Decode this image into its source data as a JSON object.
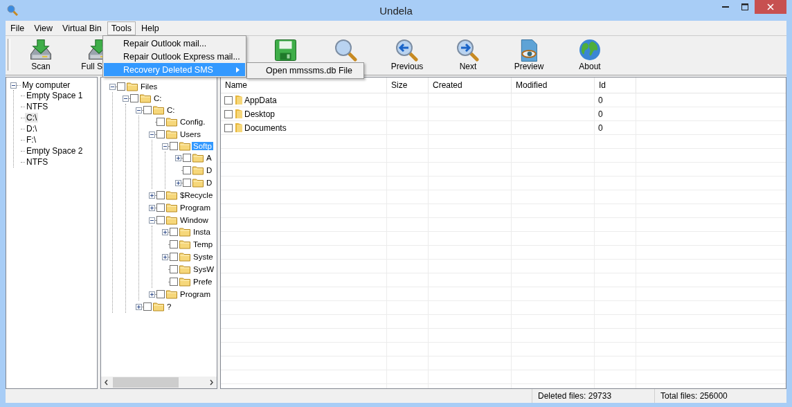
{
  "window": {
    "title": "Undela"
  },
  "menu": [
    {
      "label": "File",
      "open": false
    },
    {
      "label": "View",
      "open": false
    },
    {
      "label": "Virtual Bin",
      "open": false
    },
    {
      "label": "Tools",
      "open": true
    },
    {
      "label": "Help",
      "open": false
    }
  ],
  "dropdown": [
    {
      "label": "Repair Outlook mail...",
      "selected": false,
      "submenu": false
    },
    {
      "label": "Repair Outlook Express mail...",
      "selected": false,
      "submenu": false
    },
    {
      "label": "Recovery Deleted SMS",
      "selected": true,
      "submenu": true
    }
  ],
  "submenu": [
    {
      "label": "Open mmssms.db File"
    }
  ],
  "toolbar": [
    {
      "kind": "scan",
      "label": "Scan"
    },
    {
      "kind": "full",
      "label": "Full S"
    },
    {
      "kind": "save"
    },
    {
      "kind": "search"
    },
    {
      "kind": "previous",
      "label": "Previous"
    },
    {
      "kind": "next",
      "label": "Next"
    },
    {
      "kind": "preview",
      "label": "Preview"
    },
    {
      "kind": "about",
      "label": "About"
    }
  ],
  "computer_tree": [
    {
      "label": "My computer",
      "expander": true,
      "expanded": true,
      "selected": false,
      "children": [
        {
          "label": "Empty Space 1",
          "expander": false,
          "selected": false
        },
        {
          "label": "NTFS",
          "expander": false,
          "selected": false
        },
        {
          "label": "C:\\",
          "expander": false,
          "selected": true
        },
        {
          "label": "D:\\",
          "expander": false,
          "selected": false
        },
        {
          "label": "F:\\",
          "expander": false,
          "selected": false
        },
        {
          "label": "Empty Space 2",
          "expander": false,
          "selected": false
        },
        {
          "label": "NTFS",
          "expander": false,
          "selected": false
        }
      ]
    }
  ],
  "folder_tree": [
    {
      "label": "Files",
      "expander": true,
      "expanded": true,
      "checked": false,
      "selected": false,
      "children": [
        {
          "label": "C:",
          "expander": true,
          "expanded": true,
          "checked": false,
          "selected": false,
          "children": [
            {
              "label": "C:",
              "expander": true,
              "expanded": true,
              "checked": false,
              "selected": false,
              "children": [
                {
                  "label": "Config.",
                  "expander": false,
                  "checked": false,
                  "selected": false
                },
                {
                  "label": "Users",
                  "expander": true,
                  "expanded": true,
                  "checked": false,
                  "selected": false,
                  "children": [
                    {
                      "label": "Softp",
                      "expander": true,
                      "expanded": true,
                      "checked": false,
                      "selected": true,
                      "children": [
                        {
                          "label": "A",
                          "expander": true,
                          "expanded": false,
                          "checked": false,
                          "selected": false
                        },
                        {
                          "label": "D",
                          "expander": false,
                          "checked": false,
                          "selected": false
                        },
                        {
                          "label": "D",
                          "expander": true,
                          "expanded": false,
                          "checked": false,
                          "selected": false
                        }
                      ]
                    }
                  ]
                },
                {
                  "label": "$Recycle",
                  "expander": true,
                  "expanded": false,
                  "checked": false,
                  "selected": false
                },
                {
                  "label": "Program",
                  "expander": true,
                  "expanded": false,
                  "checked": false,
                  "selected": false
                },
                {
                  "label": "Window",
                  "expander": true,
                  "expanded": true,
                  "checked": false,
                  "selected": false,
                  "children": [
                    {
                      "label": "Insta",
                      "expander": true,
                      "expanded": false,
                      "checked": false,
                      "selected": false
                    },
                    {
                      "label": "Temp",
                      "expander": false,
                      "checked": false,
                      "selected": false
                    },
                    {
                      "label": "Syste",
                      "expander": true,
                      "expanded": false,
                      "checked": false,
                      "selected": false
                    },
                    {
                      "label": "SysW",
                      "expander": false,
                      "checked": false,
                      "selected": false
                    },
                    {
                      "label": "Prefe",
                      "expander": false,
                      "checked": false,
                      "selected": false
                    }
                  ]
                },
                {
                  "label": "Program",
                  "expander": true,
                  "expanded": false,
                  "checked": false,
                  "selected": false
                }
              ]
            },
            {
              "label": "?",
              "expander": true,
              "expanded": false,
              "checked": false,
              "selected": false
            }
          ]
        }
      ]
    }
  ],
  "table": {
    "columns": [
      "Name",
      "Size",
      "Created",
      "Modified",
      "Id"
    ],
    "rows": [
      {
        "checked": false,
        "cells": [
          "AppData",
          "",
          "",
          "",
          "0"
        ]
      },
      {
        "checked": false,
        "cells": [
          "Desktop",
          "",
          "",
          "",
          "0"
        ]
      },
      {
        "checked": false,
        "cells": [
          "Documents",
          "",
          "",
          "",
          "0"
        ]
      }
    ]
  },
  "status_bar": [
    "Deleted files: 29733",
    "Total files: 256000"
  ]
}
